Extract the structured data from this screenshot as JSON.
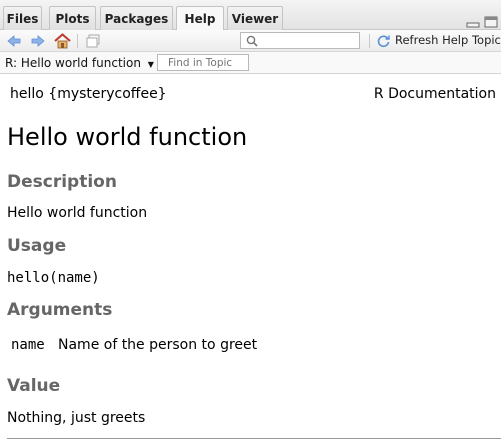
{
  "tabs": [
    {
      "label": "Files",
      "active": false
    },
    {
      "label": "Plots",
      "active": false
    },
    {
      "label": "Packages",
      "active": false
    },
    {
      "label": "Help",
      "active": true
    },
    {
      "label": "Viewer",
      "active": false
    }
  ],
  "toolbar": {
    "refresh_label": "Refresh Help Topic",
    "search_value": ""
  },
  "topic_bar": {
    "topic": "R: Hello world function",
    "find_placeholder": "Find in Topic"
  },
  "doc": {
    "header_left": "hello {mysterycoffee}",
    "header_right": "R Documentation",
    "title": "Hello world function",
    "description_heading": "Description",
    "description_text": "Hello world function",
    "usage_heading": "Usage",
    "usage_code": "hello(name)",
    "arguments_heading": "Arguments",
    "arguments": [
      {
        "name": "name",
        "desc": "Name of the person to greet"
      }
    ],
    "value_heading": "Value",
    "value_text": "Nothing, just greets"
  },
  "colors": {
    "nav_arrow": "#5b8fd6",
    "home": "#c0392b",
    "section_heading": "#666666"
  }
}
